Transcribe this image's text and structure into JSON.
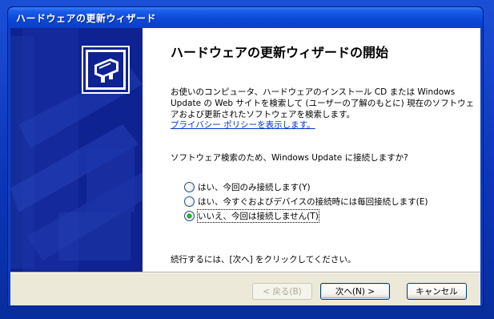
{
  "window": {
    "title": "ハードウェアの更新ウィザード"
  },
  "wizard": {
    "heading": "ハードウェアの更新ウィザードの開始",
    "description": "お使いのコンピュータ、ハードウェアのインストール CD または Windows Update の Web サイトを検索して (ユーザーの了解のもとに) 現在のソフトウェアおよび更新されたソフトウェアを検索します。",
    "privacy_link": "プライバシー ポリシーを表示します。",
    "question": "ソフトウェア検索のため、Windows Update に接続しますか?",
    "options": [
      {
        "label": "はい、今回のみ接続します(Y)",
        "checked": false
      },
      {
        "label": "はい、今すぐおよびデバイスの接続時には毎回接続します(E)",
        "checked": false
      },
      {
        "label": "いいえ、今回は接続しません(T)",
        "checked": true
      }
    ],
    "continue_text": "続行するには、[次へ] をクリックしてください。"
  },
  "buttons": {
    "back": "< 戻る(B)",
    "next": "次へ(N) >",
    "cancel": "キャンセル"
  },
  "icons": {
    "wizard_icon": "hardware-device-icon"
  }
}
